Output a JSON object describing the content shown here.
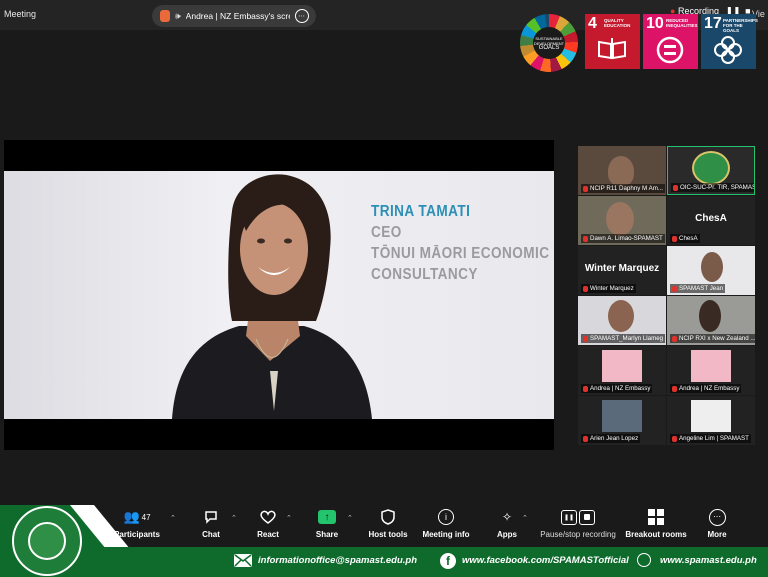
{
  "window": {
    "title": "Meeting",
    "recording_label": "Recording",
    "view_label": "Vie"
  },
  "share_indicator": {
    "text": "Andrea | NZ Embassy's scree"
  },
  "sdg": {
    "wheel_text": [
      "SUSTAINABLE",
      "DEVELOPMENT",
      "GOALS"
    ],
    "tiles": [
      {
        "num": "4",
        "label": "Quality Education",
        "color": "#c5192d"
      },
      {
        "num": "10",
        "label": "Reduced Inequalities",
        "color": "#dd1367"
      },
      {
        "num": "17",
        "label": "Partnerships for the Goals",
        "color": "#19486a"
      }
    ]
  },
  "presentation": {
    "name": "TRINA TAMATI",
    "lines": [
      "CEO",
      "TŌNUI MĀORI ECONOMIC",
      "CONSULTANCY"
    ]
  },
  "gallery": [
    {
      "name": "NCIP R11 Daphny M Am...",
      "type": "video"
    },
    {
      "name": "OIC-SUC-Pr. TIR, SPAMAST...",
      "type": "logo"
    },
    {
      "name": "Dawn A. Limao-SPAMAST",
      "type": "video"
    },
    {
      "name": "ChesA",
      "big": "ChesA",
      "type": "name"
    },
    {
      "name": "Winter Marquez",
      "big": "Winter Marquez",
      "type": "name"
    },
    {
      "name": "SPAMAST Jean",
      "type": "video"
    },
    {
      "name": "SPAMAST_Marlyn Llameg",
      "type": "video"
    },
    {
      "name": "NCIP RXI x New Zealand ...",
      "type": "video"
    },
    {
      "name": "Andrea | NZ Embassy",
      "type": "video"
    },
    {
      "name": "Andrea | NZ Embassy",
      "type": "video"
    },
    {
      "name": "Arien Jean Lopez",
      "type": "video"
    },
    {
      "name": "Angeline Lim | SPAMAST",
      "type": "video"
    }
  ],
  "toolbar": {
    "participants_label": "Participants",
    "participants_count": "47",
    "chat_label": "Chat",
    "react_label": "React",
    "share_label": "Share",
    "host_tools_label": "Host tools",
    "meeting_info_label": "Meeting info",
    "apps_label": "Apps",
    "recording_label": "Pause/stop recording",
    "breakout_label": "Breakout rooms",
    "more_label": "More"
  },
  "footer": {
    "email": "informationoffice@spamast.edu.ph",
    "facebook": "www.facebook.com/SPAMASTofficial",
    "website": "www.spamast.edu.ph"
  },
  "colors": {
    "accent_green": "#0e6b2c",
    "name_blue": "#2c8fb5",
    "share_green": "#23c46b",
    "mic_red": "#e0322b"
  }
}
